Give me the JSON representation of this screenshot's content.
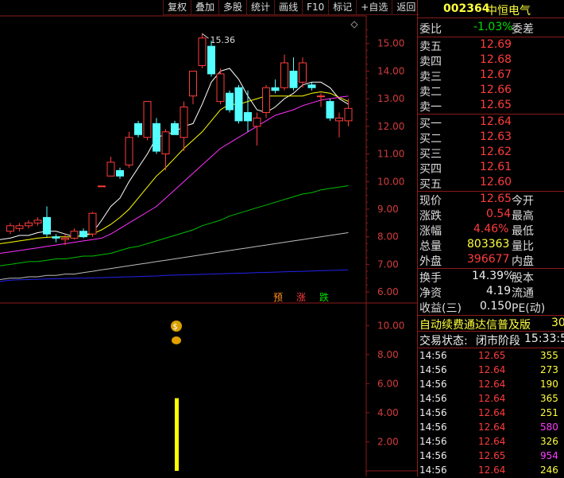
{
  "toolbar": [
    "复权",
    "叠加",
    "多股",
    "统计",
    "画线",
    "F10",
    "标记",
    "+自选",
    "返回"
  ],
  "chart": {
    "price_axis": [
      "15.00",
      "14.00",
      "13.00",
      "12.00",
      "11.00",
      "10.00",
      "9.00",
      "8.00",
      "7.00",
      "6.00"
    ],
    "vol_axis": [
      "10.00",
      "8.00",
      "6.00",
      "4.00",
      "2.00"
    ],
    "high_label": "15.36",
    "markers": [
      "预",
      "涨",
      "跌"
    ],
    "colors": {
      "up": "#ff3c3c",
      "down": "#54ffff",
      "ma5": "#ffffff",
      "ma10": "#ffff00",
      "ma20": "#ff30ff",
      "ma60": "#00c000",
      "ma120": "#bbbbbb",
      "ma250": "#2222ee",
      "axis": "#8b1a1a",
      "volume": "#ffff00"
    }
  },
  "chart_data": {
    "type": "candlestick",
    "ylim": [
      5.6,
      16.0
    ],
    "candles": [
      {
        "o": 8.2,
        "h": 8.5,
        "l": 8.1,
        "c": 8.4
      },
      {
        "o": 8.3,
        "h": 8.5,
        "l": 8.2,
        "c": 8.4
      },
      {
        "o": 8.4,
        "h": 8.6,
        "l": 8.3,
        "c": 8.5
      },
      {
        "o": 8.5,
        "h": 8.7,
        "l": 8.4,
        "c": 8.6
      },
      {
        "o": 8.7,
        "h": 9.1,
        "l": 8.0,
        "c": 8.1
      },
      {
        "o": 8.0,
        "h": 8.1,
        "l": 7.8,
        "c": 7.95
      },
      {
        "o": 7.9,
        "h": 8.1,
        "l": 7.7,
        "c": 7.95
      },
      {
        "o": 7.95,
        "h": 8.3,
        "l": 7.9,
        "c": 8.2
      },
      {
        "o": 8.2,
        "h": 8.3,
        "l": 7.95,
        "c": 8.0
      },
      {
        "o": 8.1,
        "h": 8.9,
        "l": 8.0,
        "c": 8.85
      },
      {
        "o": 9.84,
        "h": 9.84,
        "l": 9.84,
        "c": 9.84
      },
      {
        "o": 10.2,
        "h": 10.9,
        "l": 10.2,
        "c": 10.7
      },
      {
        "o": 10.4,
        "h": 10.5,
        "l": 10.1,
        "c": 10.2
      },
      {
        "o": 10.6,
        "h": 11.8,
        "l": 10.5,
        "c": 11.6
      },
      {
        "o": 12.1,
        "h": 12.2,
        "l": 11.6,
        "c": 11.7
      },
      {
        "o": 11.6,
        "h": 12.9,
        "l": 11.5,
        "c": 12.9
      },
      {
        "o": 12.1,
        "h": 12.3,
        "l": 11.0,
        "c": 11.1
      },
      {
        "o": 11.0,
        "h": 11.9,
        "l": 10.4,
        "c": 11.8
      },
      {
        "o": 12.1,
        "h": 12.2,
        "l": 11.7,
        "c": 11.7
      },
      {
        "o": 11.6,
        "h": 12.9,
        "l": 11.1,
        "c": 12.7
      },
      {
        "o": 13.1,
        "h": 14.0,
        "l": 12.8,
        "c": 14.0
      },
      {
        "o": 14.2,
        "h": 15.36,
        "l": 14.1,
        "c": 15.2
      },
      {
        "o": 14.9,
        "h": 15.1,
        "l": 13.8,
        "c": 13.9
      },
      {
        "o": 12.9,
        "h": 14.1,
        "l": 12.8,
        "c": 13.9
      },
      {
        "o": 13.2,
        "h": 13.3,
        "l": 12.5,
        "c": 12.6
      },
      {
        "o": 13.4,
        "h": 13.5,
        "l": 12.1,
        "c": 12.2
      },
      {
        "o": 12.5,
        "h": 13.3,
        "l": 11.8,
        "c": 12.2
      },
      {
        "o": 12.0,
        "h": 12.5,
        "l": 11.3,
        "c": 12.3
      },
      {
        "o": 12.5,
        "h": 13.5,
        "l": 12.3,
        "c": 13.4
      },
      {
        "o": 13.4,
        "h": 13.7,
        "l": 13.2,
        "c": 13.3
      },
      {
        "o": 13.4,
        "h": 14.6,
        "l": 13.3,
        "c": 14.3
      },
      {
        "o": 14.0,
        "h": 14.5,
        "l": 13.3,
        "c": 13.4
      },
      {
        "o": 13.6,
        "h": 14.5,
        "l": 13.4,
        "c": 14.3
      },
      {
        "o": 13.5,
        "h": 13.6,
        "l": 13.3,
        "c": 13.4
      },
      {
        "o": 13.1,
        "h": 13.2,
        "l": 12.7,
        "c": 13.1
      },
      {
        "o": 12.9,
        "h": 13.0,
        "l": 12.2,
        "c": 12.3
      },
      {
        "o": 12.2,
        "h": 12.5,
        "l": 11.6,
        "c": 12.3
      },
      {
        "o": 12.2,
        "h": 13.0,
        "l": 12.0,
        "c": 12.65
      }
    ],
    "ma": {
      "ma5": [
        7.95,
        8.05,
        8.05,
        8.15,
        8.2,
        8.2,
        8.1,
        8.0,
        8.05,
        8.15,
        8.6,
        9.1,
        9.4,
        10.0,
        10.5,
        11.0,
        11.6,
        11.7,
        11.8,
        12.0,
        12.1,
        12.8,
        13.6,
        14.0,
        14.1,
        13.7,
        13.1,
        12.6,
        12.5,
        12.7,
        13.0,
        13.2,
        13.5,
        13.6,
        13.6,
        13.4,
        13.0,
        12.8
      ],
      "ma10": [
        7.8,
        7.85,
        7.9,
        7.95,
        7.98,
        8.0,
        8.0,
        8.0,
        8.05,
        8.1,
        8.25,
        8.45,
        8.7,
        9.0,
        9.4,
        9.8,
        10.2,
        10.5,
        10.85,
        11.2,
        11.5,
        11.8,
        12.2,
        12.6,
        12.8,
        12.8,
        12.9,
        13.0,
        13.1,
        13.1,
        13.1,
        13.1,
        13.1,
        13.2,
        13.25,
        13.2,
        13.05,
        12.9
      ],
      "ma20": [
        7.45,
        7.5,
        7.55,
        7.6,
        7.65,
        7.7,
        7.75,
        7.8,
        7.85,
        7.9,
        7.95,
        8.1,
        8.3,
        8.5,
        8.7,
        8.9,
        9.1,
        9.4,
        9.7,
        10.0,
        10.3,
        10.6,
        10.9,
        11.2,
        11.4,
        11.6,
        11.8,
        12.0,
        12.2,
        12.4,
        12.5,
        12.6,
        12.75,
        12.85,
        12.95,
        13.0,
        13.05,
        13.1
      ],
      "ma60": [
        7.0,
        7.05,
        7.1,
        7.1,
        7.15,
        7.2,
        7.2,
        7.25,
        7.3,
        7.3,
        7.35,
        7.4,
        7.5,
        7.6,
        7.65,
        7.75,
        7.85,
        7.95,
        8.05,
        8.15,
        8.25,
        8.4,
        8.5,
        8.6,
        8.75,
        8.85,
        8.95,
        9.05,
        9.15,
        9.25,
        9.35,
        9.45,
        9.55,
        9.6,
        9.7,
        9.75,
        9.8,
        9.85
      ],
      "ma120": [
        6.5,
        6.5,
        6.55,
        6.55,
        6.6,
        6.6,
        6.65,
        6.65,
        6.7,
        6.75,
        6.8,
        6.85,
        6.9,
        6.95,
        7.0,
        7.05,
        7.1,
        7.15,
        7.2,
        7.25,
        7.3,
        7.35,
        7.4,
        7.45,
        7.5,
        7.55,
        7.6,
        7.65,
        7.7,
        7.75,
        7.8,
        7.85,
        7.9,
        7.95,
        8.0,
        8.05,
        8.1,
        8.15
      ],
      "ma250": [
        6.43,
        6.44,
        6.45,
        6.46,
        6.47,
        6.48,
        6.49,
        6.5,
        6.5,
        6.51,
        6.52,
        6.53,
        6.54,
        6.55,
        6.56,
        6.57,
        6.58,
        6.6,
        6.61,
        6.62,
        6.63,
        6.64,
        6.65,
        6.66,
        6.67,
        6.68,
        6.69,
        6.7,
        6.71,
        6.72,
        6.73,
        6.74,
        6.75,
        6.76,
        6.77,
        6.78,
        6.79,
        6.8
      ]
    },
    "volume": {
      "ylim": [
        0,
        11.0
      ],
      "bars": [
        {
          "index": 18,
          "value": 5.0
        }
      ]
    }
  },
  "quote": {
    "code": "002364",
    "name": "中恒电气",
    "weibi_label": "委比",
    "weibi_value": "-1.03%",
    "weicha_label": "委差",
    "asks": [
      {
        "label": "卖五",
        "price": "12.69"
      },
      {
        "label": "卖四",
        "price": "12.68"
      },
      {
        "label": "卖三",
        "price": "12.67"
      },
      {
        "label": "卖二",
        "price": "12.66"
      },
      {
        "label": "卖一",
        "price": "12.65"
      }
    ],
    "bids": [
      {
        "label": "买一",
        "price": "12.64"
      },
      {
        "label": "买二",
        "price": "12.63"
      },
      {
        "label": "买三",
        "price": "12.62"
      },
      {
        "label": "买四",
        "price": "12.61"
      },
      {
        "label": "买五",
        "price": "12.60"
      }
    ],
    "stats": [
      {
        "l": "现价",
        "v": "12.65",
        "r": "今开"
      },
      {
        "l": "涨跌",
        "v": "0.54",
        "r": "最高"
      },
      {
        "l": "涨幅",
        "v": "4.46%",
        "r": "最低"
      },
      {
        "l": "总量",
        "v": "803363",
        "r": "量比"
      },
      {
        "l": "外盘",
        "v": "396677",
        "r": "内盘"
      }
    ],
    "stats2": [
      {
        "l": "换手",
        "v": "14.39%",
        "r": "股本"
      },
      {
        "l": "净资",
        "v": "4.19",
        "r": "流通"
      },
      {
        "l": "收益(三)",
        "v": "0.150",
        "r": "PE(动)"
      }
    ],
    "banner": "自动续费通达信普及版",
    "banner_num": "30",
    "status_label": "交易状态:",
    "status_value": "闭市阶段",
    "status_time": "15:33:5",
    "trades": [
      {
        "t": "14:56",
        "p": "12.65",
        "v": "355"
      },
      {
        "t": "14:56",
        "p": "12.64",
        "v": "273"
      },
      {
        "t": "14:56",
        "p": "12.64",
        "v": "190"
      },
      {
        "t": "14:56",
        "p": "12.64",
        "v": "365"
      },
      {
        "t": "14:56",
        "p": "12.64",
        "v": "251"
      },
      {
        "t": "14:56",
        "p": "12.64",
        "v": "580"
      },
      {
        "t": "14:56",
        "p": "12.64",
        "v": "326"
      },
      {
        "t": "14:56",
        "p": "12.65",
        "v": "954"
      },
      {
        "t": "14:56",
        "p": "12.64",
        "v": "246"
      }
    ]
  }
}
